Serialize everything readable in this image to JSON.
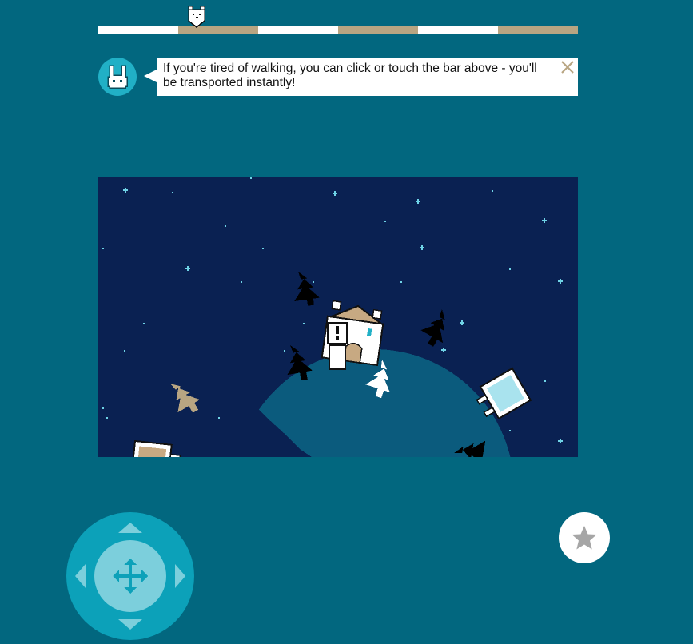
{
  "progress": {
    "segments": [
      "#ffffff",
      "#b8a582",
      "#ffffff",
      "#b8a582",
      "#ffffff",
      "#b8a582"
    ],
    "current_segment": 2,
    "marker_icon": "polar-bear-icon"
  },
  "dialog": {
    "speaker_icon": "bunny-icon",
    "text": "If you're tired of walking, you can click or touch the bar above - you'll be transported instantly!",
    "close_icon": "close-icon"
  },
  "scene": {
    "sky_color": "#0a2152",
    "planet_color": "#0b5b7d",
    "objects": [
      "pine-tree-icon",
      "house-icon",
      "polar-bear-icon",
      "signpost-icon"
    ]
  },
  "controls": {
    "dpad": [
      "arrow-up-icon",
      "arrow-down-icon",
      "arrow-left-icon",
      "arrow-right-icon",
      "move-icon"
    ],
    "favorite_icon": "star-icon"
  },
  "colors": {
    "background": "#02677f",
    "accent": "#21b0c6",
    "tan": "#b8a582"
  }
}
